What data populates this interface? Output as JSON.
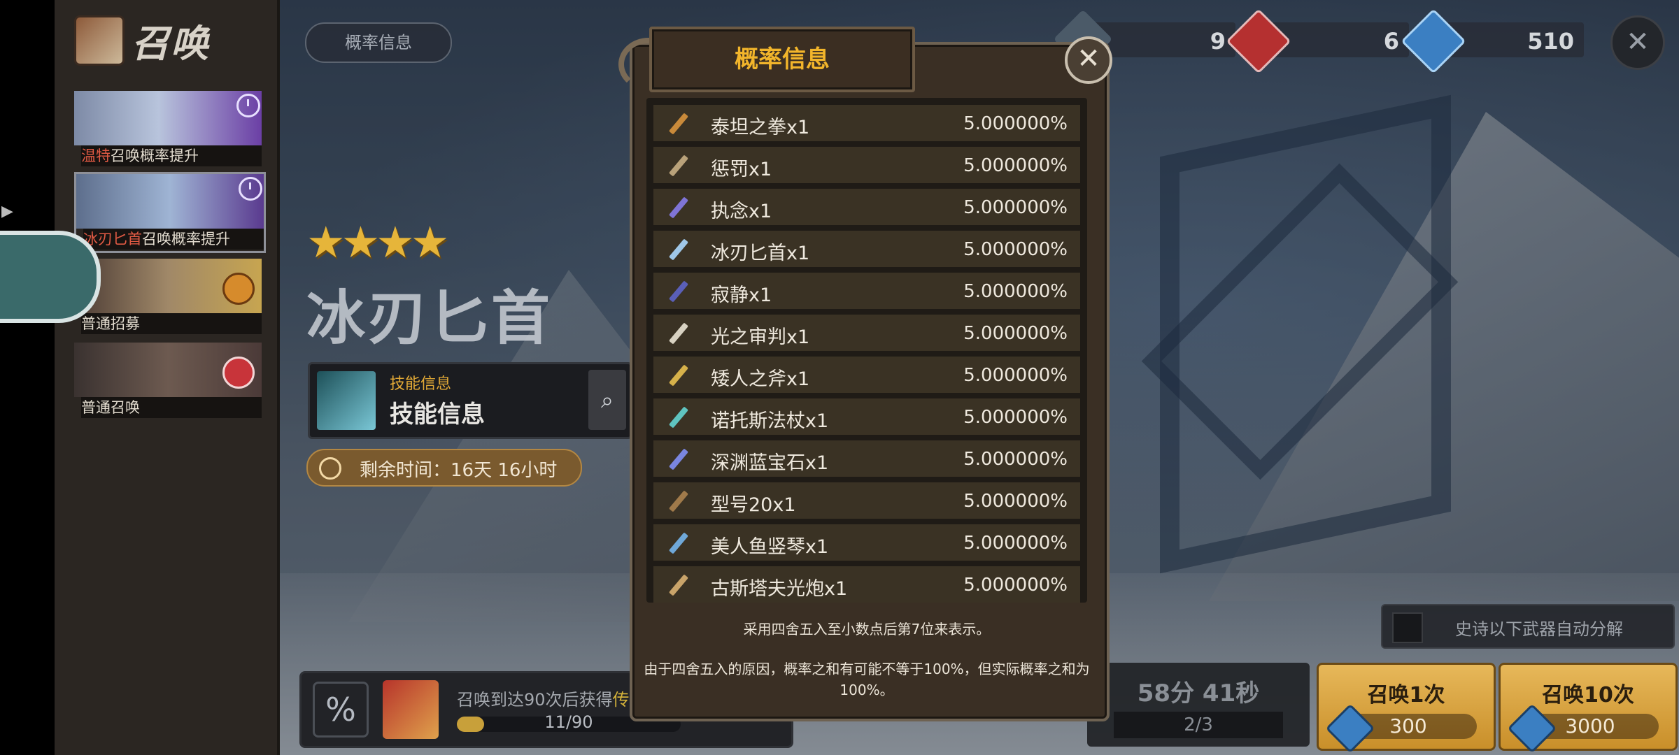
{
  "sidebar": {
    "title": "召唤",
    "banners": [
      {
        "highlight": "温特",
        "label": "召唤概率提升"
      },
      {
        "highlight": "冰刃匕首",
        "label": "召唤概率提升"
      },
      {
        "highlight": "",
        "label": "普通招募"
      },
      {
        "highlight": "",
        "label": "普通召唤"
      }
    ]
  },
  "top": {
    "prob_tab": "概率信息",
    "currencies": [
      {
        "icon": "token-icon",
        "value": "9"
      },
      {
        "icon": "red-ticket-icon",
        "value": "6"
      },
      {
        "icon": "gem-icon",
        "value": "510"
      }
    ]
  },
  "banner_detail": {
    "stars": "★★★★",
    "weapon_name": "冰刃匕首",
    "skill_small": "技能信息",
    "skill_big": "技能信息",
    "time_label": "剩余时间：16天 16小时"
  },
  "pity": {
    "pct_label": "%",
    "text_prefix": "召唤到达90次后获得",
    "text_highlight": "传",
    "count": "11/90",
    "progress": 0.122
  },
  "auto_decompose": {
    "label": "史诗以下武器自动分解"
  },
  "cooldown": {
    "time": "58分 41秒",
    "count": "2/3"
  },
  "summon_buttons": [
    {
      "label": "召唤1次",
      "cost": "300"
    },
    {
      "label": "召唤10次",
      "cost": "3000"
    }
  ],
  "modal": {
    "title": "概率信息",
    "items": [
      {
        "name": "泰坦之拳x1",
        "pct": "5.000000%",
        "color": "#c98a3a"
      },
      {
        "name": "惩罚x1",
        "pct": "5.000000%",
        "color": "#b9a27a"
      },
      {
        "name": "执念x1",
        "pct": "5.000000%",
        "color": "#7f74d6"
      },
      {
        "name": "冰刃匕首x1",
        "pct": "5.000000%",
        "color": "#9fc7e8"
      },
      {
        "name": "寂静x1",
        "pct": "5.000000%",
        "color": "#5a5fb8"
      },
      {
        "name": "光之审判x1",
        "pct": "5.000000%",
        "color": "#d8d2c2"
      },
      {
        "name": "矮人之斧x1",
        "pct": "5.000000%",
        "color": "#d6b14a"
      },
      {
        "name": "诺托斯法杖x1",
        "pct": "5.000000%",
        "color": "#5fc4c0"
      },
      {
        "name": "深渊蓝宝石x1",
        "pct": "5.000000%",
        "color": "#7a86e0"
      },
      {
        "name": "型号20x1",
        "pct": "5.000000%",
        "color": "#a07a4a"
      },
      {
        "name": "美人鱼竖琴x1",
        "pct": "5.000000%",
        "color": "#6fa8d8"
      },
      {
        "name": "古斯塔夫光炮x1",
        "pct": "5.000000%",
        "color": "#c9a46a"
      }
    ],
    "note_1": "采用四舍五入至小数点后第7位来表示。",
    "note_2": "由于四舍五入的原因，概率之和有可能不等于100%，但实际概率之和为100%。"
  }
}
